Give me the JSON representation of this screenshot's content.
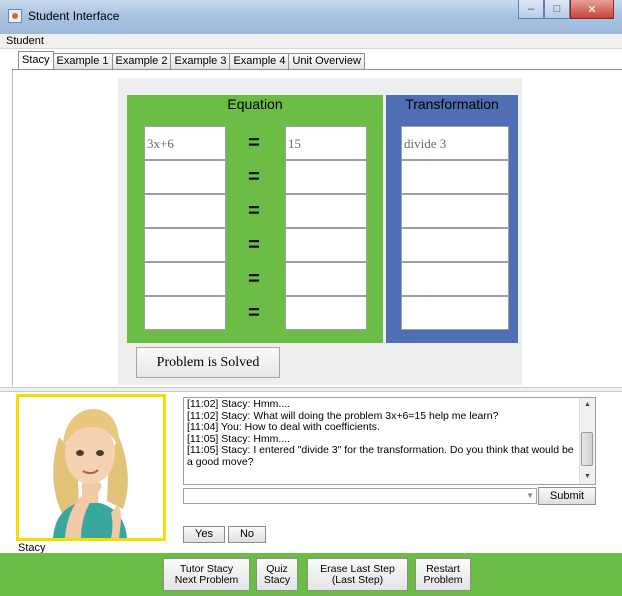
{
  "window": {
    "title": "Student Interface",
    "minimize": "–",
    "maximize": "□",
    "close": "✕"
  },
  "menu": {
    "student": "Student"
  },
  "tabs": [
    "Stacy",
    "Example 1",
    "Example 2",
    "Example 3",
    "Example 4",
    "Unit Overview"
  ],
  "equation": {
    "header": "Equation",
    "equals": "=",
    "rows": [
      {
        "left": "3x+6",
        "right": "15"
      },
      {
        "left": "",
        "right": ""
      },
      {
        "left": "",
        "right": ""
      },
      {
        "left": "",
        "right": ""
      },
      {
        "left": "",
        "right": ""
      },
      {
        "left": "",
        "right": ""
      }
    ]
  },
  "transformation": {
    "header": "Transformation",
    "rows": [
      "divide 3",
      "",
      "",
      "",
      "",
      ""
    ]
  },
  "solved_button": "Problem is Solved",
  "avatar": {
    "name": "Stacy"
  },
  "chat": {
    "lines": [
      "[11:02] Stacy: Hmm....",
      "[11:02] Stacy: What will doing the problem 3x+6=15 help me learn?",
      "[11:04] You: How to deal with coefficients.",
      "[11:05] Stacy: Hmm....",
      "[11:05] Stacy: I entered \"divide 3\" for the transformation. Do you think that would be a good move?"
    ],
    "input_value": "",
    "submit": "Submit",
    "yes": "Yes",
    "no": "No"
  },
  "bottom_buttons": [
    {
      "line1": "Tutor Stacy",
      "line2": "Next Problem"
    },
    {
      "line1": "Quiz",
      "line2": "Stacy"
    },
    {
      "line1": "Erase Last Step",
      "line2": "(Last Step)"
    },
    {
      "line1": "Restart",
      "line2": "Problem"
    }
  ],
  "colors": {
    "equation_panel": "#6cbd45",
    "transformation_panel": "#4f6eb3",
    "avatar_border": "#f0e000",
    "bottom_bar": "#6cbd45"
  }
}
